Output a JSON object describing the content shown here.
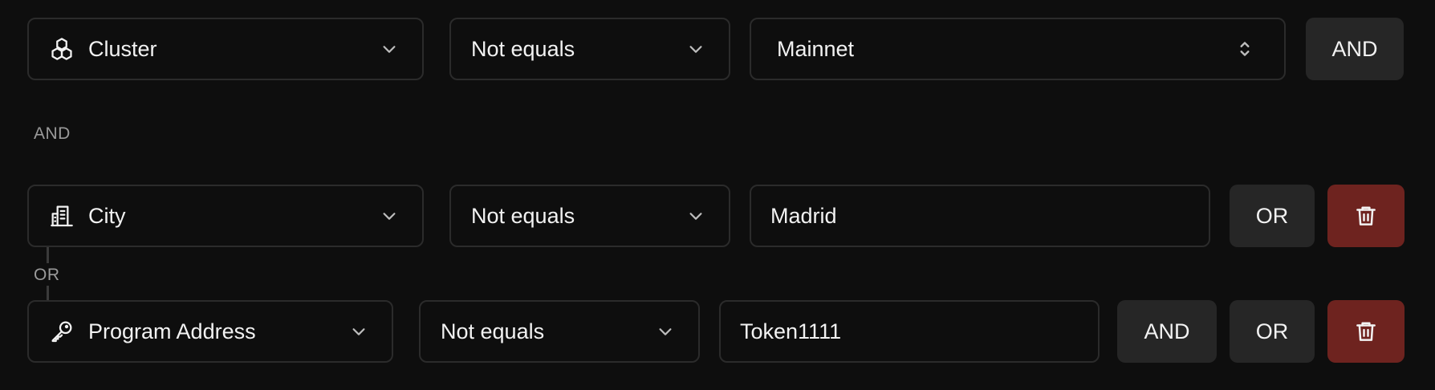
{
  "rows": [
    {
      "field": {
        "label": "Cluster",
        "icon": "cubes-icon"
      },
      "operator": {
        "label": "Not equals"
      },
      "value": {
        "label": "Mainnet",
        "type": "select"
      },
      "actions": [
        "AND"
      ]
    },
    {
      "field": {
        "label": "City",
        "icon": "building-icon"
      },
      "operator": {
        "label": "Not equals"
      },
      "value": {
        "label": "Madrid",
        "type": "text"
      },
      "actions": [
        "OR"
      ],
      "delete": true
    },
    {
      "field": {
        "label": "Program Address",
        "icon": "key-icon"
      },
      "operator": {
        "label": "Not equals"
      },
      "value": {
        "label": "Token1111",
        "type": "text"
      },
      "actions": [
        "AND",
        "OR"
      ],
      "delete": true
    }
  ],
  "conjunctions": {
    "group_joiner": "AND",
    "inner_joiner": "OR"
  },
  "colors": {
    "background": "#0e0e0e",
    "border": "#2b2b2b",
    "button": "#262626",
    "danger": "#6e231f",
    "muted_text": "#9a9a9a",
    "text": "#f2f2f2"
  },
  "icons": {
    "chevron": "chevron-down-icon",
    "updown": "chevron-updown-icon",
    "delete": "trash-icon"
  }
}
